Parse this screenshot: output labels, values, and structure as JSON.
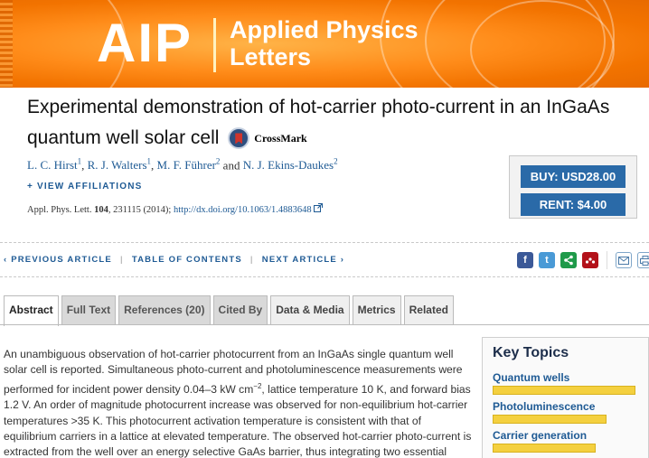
{
  "banner": {
    "logo": "AIP",
    "journal_line1": "Applied Physics",
    "journal_line2": "Letters"
  },
  "article": {
    "title_part1": "Experimental demonstration of hot-carrier photo-current in an InGaAs",
    "title_part2": "quantum well solar cell",
    "crossmark": "CrossMark",
    "authors": [
      {
        "name": "L. C. Hirst",
        "sup": "1"
      },
      {
        "name": "R. J. Walters",
        "sup": "1"
      },
      {
        "name": "M. F. Führer",
        "sup": "2"
      },
      {
        "name": "N. J. Ekins-Daukes",
        "sup": "2"
      }
    ],
    "and": "and",
    "view_affiliations": "+ VIEW AFFILIATIONS",
    "citation_journal": "Appl. Phys. Lett.",
    "citation_volume": "104",
    "citation_rest": ", 231115 (2014);",
    "doi": "http://dx.doi.org/10.1063/1.4883648"
  },
  "purchase": {
    "buy": "BUY: USD28.00",
    "rent": "RENT: $4.00"
  },
  "article_nav": {
    "previous": "PREVIOUS ARTICLE",
    "toc": "TABLE OF CONTENTS",
    "next": "NEXT ARTICLE"
  },
  "social_icons": [
    "facebook-icon",
    "twitter-icon",
    "share-icon",
    "mendeley-icon",
    "email-icon",
    "print-icon"
  ],
  "tabs": [
    {
      "label": "Abstract",
      "state": "active"
    },
    {
      "label": "Full Text",
      "state": "inactive"
    },
    {
      "label": "References (20)",
      "state": "inactive"
    },
    {
      "label": "Cited By",
      "state": "inactive"
    },
    {
      "label": "Data & Media",
      "state": "light"
    },
    {
      "label": "Metrics",
      "state": "light"
    },
    {
      "label": "Related",
      "state": "light"
    }
  ],
  "abstract": {
    "p1": "An unambiguous observation of hot-carrier photocurrent from an InGaAs single quantum well solar cell is reported. Simultaneous photo-current and photoluminescence measurements were performed for incident power density 0.04–3 kW cm",
    "sup": "−2",
    "p2": ", lattice temperature 10 K, and forward bias 1.2 V. An order of magnitude photocurrent increase was observed for non-equilibrium hot-carrier temperatures >35 K. This photocurrent activation temperature is consistent with that of equilibrium carriers in a lattice at elevated temperature. The observed hot-carrier photo-current is extracted from the well over an energy selective GaAs barrier, thus integrating two essential components of"
  },
  "key_topics": {
    "heading": "Key Topics",
    "items": [
      {
        "label": "Quantum wells",
        "level": 1.0
      },
      {
        "label": "Photoluminescence",
        "level": 0.8
      },
      {
        "label": "Carrier generation",
        "level": 0.72
      }
    ]
  }
}
